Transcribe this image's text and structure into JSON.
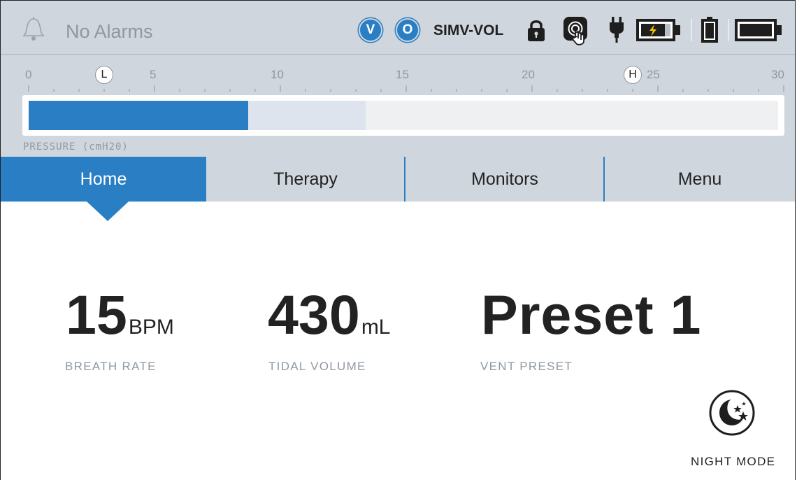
{
  "status": {
    "alarm_text": "No Alarms",
    "badges": [
      "V",
      "O"
    ],
    "mode": "SIMV-VOL",
    "icons": [
      "bell-icon",
      "lock-icon",
      "touch-icon",
      "ac-power-plug-icon",
      "internal-battery-charging-icon",
      "removable-battery-icon",
      "external-battery-icon"
    ],
    "accent_color": "#2a7fc4",
    "charging_color": "#f2c500"
  },
  "pressure": {
    "ticks": [
      "0",
      "5",
      "10",
      "15",
      "20",
      "25",
      "30"
    ],
    "scale_max": 30,
    "low_marker": {
      "label": "L",
      "value": 3
    },
    "high_marker": {
      "label": "H",
      "value": 24
    },
    "current_value": 8.8,
    "peak_value": 13.5,
    "label": "PRESSURE (cmH20)"
  },
  "tabs": [
    {
      "label": "Home",
      "active": true
    },
    {
      "label": "Therapy",
      "active": false
    },
    {
      "label": "Monitors",
      "active": false
    },
    {
      "label": "Menu",
      "active": false
    }
  ],
  "readouts": {
    "breath_rate": {
      "value": "15",
      "unit": "BPM",
      "caption": "BREATH RATE"
    },
    "tidal_volume": {
      "value": "430",
      "unit": "mL",
      "caption": "TIDAL VOLUME"
    },
    "vent_preset": {
      "value": "Preset 1",
      "caption": "VENT PRESET"
    }
  },
  "night_mode": {
    "label": "NIGHT MODE",
    "icon": "moon-stars-icon"
  }
}
